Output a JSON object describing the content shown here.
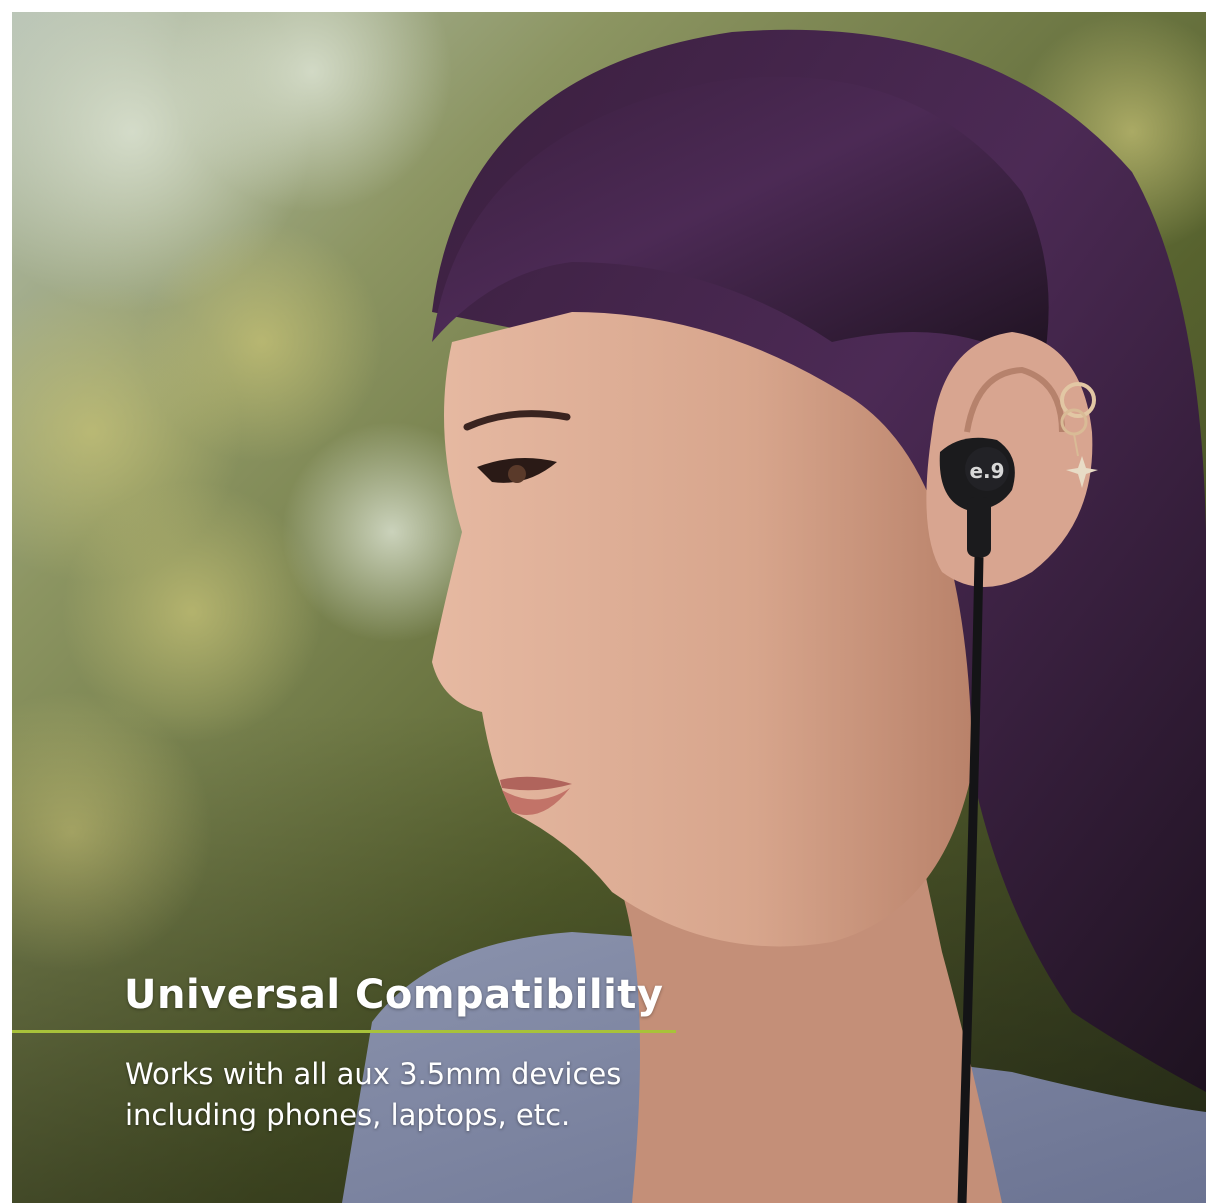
{
  "brand": {
    "logo_text": "e.9",
    "accent_color": "#a8c23a"
  },
  "caption": {
    "headline": "Universal Compatibility",
    "line1": "Works with all aux 3.5mm devices",
    "line2": "including phones, laptops, etc."
  }
}
